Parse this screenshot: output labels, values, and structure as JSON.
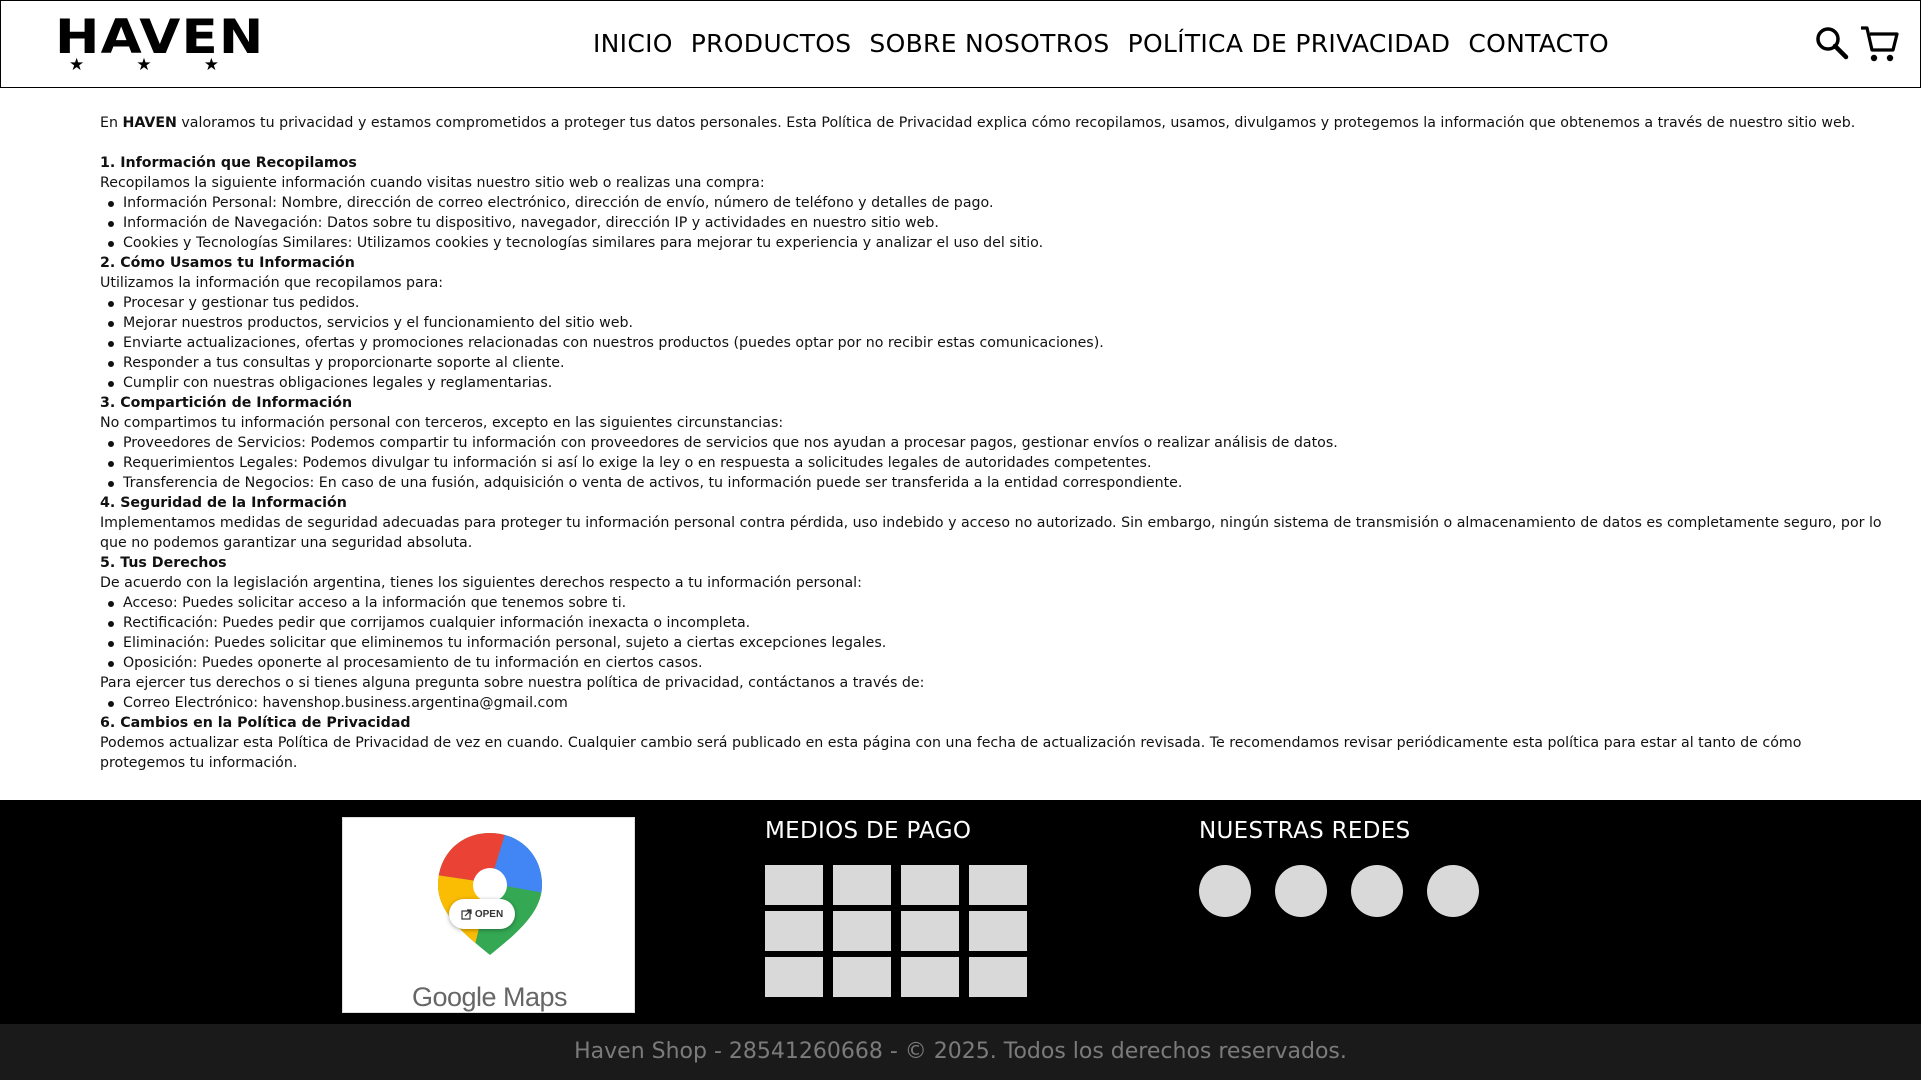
{
  "header": {
    "logo_text": "HAVEN",
    "logo_stars": [
      "★",
      "★",
      "★"
    ],
    "nav": [
      {
        "label": "INICIO"
      },
      {
        "label": "PRODUCTOS"
      },
      {
        "label": "SOBRE NOSOTROS"
      },
      {
        "label": "POLÍTICA DE PRIVACIDAD"
      },
      {
        "label": "CONTACTO"
      }
    ],
    "search_icon": "search-icon",
    "cart_icon": "cart-icon"
  },
  "policy": {
    "intro_prefix": "En ",
    "intro_brand": "HAVEN",
    "intro_rest": " valoramos tu privacidad y estamos comprometidos a proteger tus datos personales. Esta Política de Privacidad explica cómo recopilamos, usamos, divulgamos y protegemos la información que obtenemos a través de nuestro sitio web.",
    "sections": [
      {
        "title": "1. Información que Recopilamos",
        "text": "Recopilamos la siguiente información cuando visitas nuestro sitio web o realizas una compra:",
        "bullets": [
          "Información Personal: Nombre, dirección de correo electrónico, dirección de envío, número de teléfono y detalles de pago.",
          "Información de Navegación: Datos sobre tu dispositivo, navegador, dirección IP y actividades en nuestro sitio web.",
          "Cookies y Tecnologías Similares: Utilizamos cookies y tecnologías similares para mejorar tu experiencia y analizar el uso del sitio."
        ]
      },
      {
        "title": "2. Cómo Usamos tu Información",
        "text": "Utilizamos la información que recopilamos para:",
        "bullets": [
          "Procesar y gestionar tus pedidos.",
          "Mejorar nuestros productos, servicios y el funcionamiento del sitio web.",
          "Enviarte actualizaciones, ofertas y promociones relacionadas con nuestros productos (puedes optar por no recibir estas comunicaciones).",
          "Responder a tus consultas y proporcionarte soporte al cliente.",
          "Cumplir con nuestras obligaciones legales y reglamentarias."
        ]
      },
      {
        "title": "3. Compartición de Información",
        "text": "No compartimos tu información personal con terceros, excepto en las siguientes circunstancias:",
        "bullets": [
          "Proveedores de Servicios: Podemos compartir tu información con proveedores de servicios que nos ayudan a procesar pagos, gestionar envíos o realizar análisis de datos.",
          "Requerimientos Legales: Podemos divulgar tu información si así lo exige la ley o en respuesta a solicitudes legales de autoridades competentes.",
          "Transferencia de Negocios: En caso de una fusión, adquisición o venta de activos, tu información puede ser transferida a la entidad correspondiente."
        ]
      },
      {
        "title": "4. Seguridad de la Información",
        "text": "Implementamos medidas de seguridad adecuadas para proteger tu información personal contra pérdida, uso indebido y acceso no autorizado. Sin embargo, ningún sistema de transmisión o almacenamiento de datos es completamente seguro, por lo que no podemos garantizar una seguridad absoluta.",
        "bullets": []
      },
      {
        "title": "5. Tus Derechos",
        "text": "De acuerdo con la legislación argentina, tienes los siguientes derechos respecto a tu información personal:",
        "bullets": [
          "Acceso: Puedes solicitar acceso a la información que tenemos sobre ti.",
          "Rectificación: Puedes pedir que corrijamos cualquier información inexacta o incompleta.",
          "Eliminación: Puedes solicitar que eliminemos tu información personal, sujeto a ciertas excepciones legales.",
          "Oposición: Puedes oponerte al procesamiento de tu información en ciertos casos."
        ],
        "text_after": "Para ejercer tus derechos o si tienes alguna pregunta sobre nuestra política de privacidad, contáctanos a través de:",
        "bullets_after": [
          "Correo Electrónico: havenshop.business.argentina@gmail.com"
        ]
      },
      {
        "title": "6. Cambios en la Política de Privacidad",
        "text": "Podemos actualizar esta Política de Privacidad de vez en cuando. Cualquier cambio será publicado en esta página con una fecha de actualización revisada. Te recomendamos revisar periódicamente esta política para estar al tanto de cómo protegemos tu información.",
        "bullets": []
      }
    ]
  },
  "footer": {
    "map": {
      "open_label": "OPEN",
      "brand": "Google Maps",
      "colors": {
        "red": "#ea4335",
        "blue": "#4285f4",
        "green": "#34a853",
        "yellow": "#fbbc04"
      }
    },
    "payments_title": "MEDIOS DE PAGO",
    "payment_tile_count": 12,
    "social_title": "NUESTRAS REDES",
    "social_count": 4,
    "copyright": "Haven Shop - 28541260668 - © 2025. Todos los derechos reservados."
  },
  "colors": {
    "footer_bg": "#000000",
    "copyright_bg": "#1a1a1a",
    "placeholder_tile": "#d9d9d9"
  }
}
